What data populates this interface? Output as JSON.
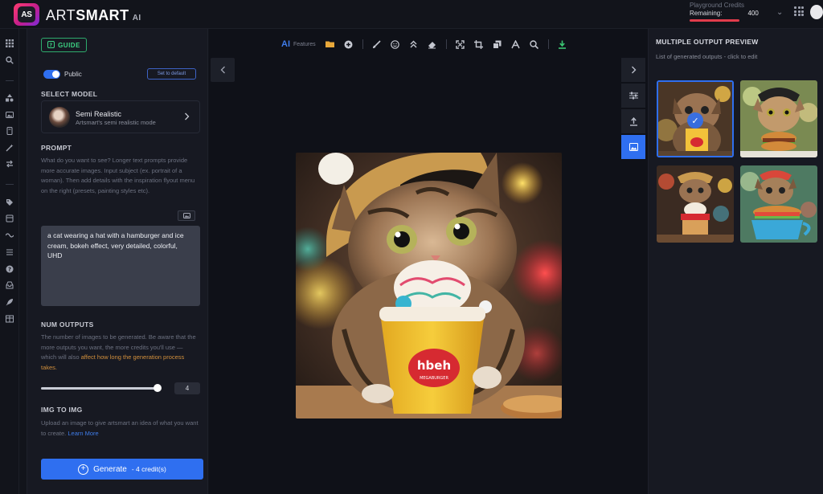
{
  "app": {
    "logo_badge": "AS",
    "logo_word1": "ART",
    "logo_word2": "SMART",
    "logo_suffix": "AI"
  },
  "credits": {
    "title": "Playground Credits",
    "remaining_label": "Remaining:",
    "remaining_value": "400",
    "bar_fraction": 1.0,
    "bar_color": "#e13c4b"
  },
  "rail_icons": [
    "grid-icon",
    "search-icon",
    "shapes-icon",
    "image-icon",
    "book-icon",
    "magic-wand-icon",
    "swap-icon",
    "tag-icon",
    "collection-icon",
    "wave-icon",
    "list-icon",
    "help-icon",
    "inbox-icon",
    "rocket-icon",
    "table-icon"
  ],
  "left": {
    "guide_label": "GUIDE",
    "public_label": "Public",
    "set_default_label": "Set to default",
    "select_model_label": "SELECT MODEL",
    "model_name": "Semi Realistic",
    "model_desc": "Artsmart's semi realistic mode",
    "prompt_label": "PROMPT",
    "prompt_help": "What do you want to see? Longer text prompts provide more accurate images. Input subject (ex. portrait of a woman). Then add details with the inspiration flyout menu on the right (presets, painting styles etc).",
    "prompt_value": "a cat wearing a hat with a hamburger and ice cream, bokeh effect, very detailed, colorful, UHD",
    "num_outputs_label": "NUM OUTPUTS",
    "num_outputs_help_1": "The number of images to be generated. Be aware that the more outputs you want, the more credits you'll use — which will also ",
    "num_outputs_help_hl": "affect how long the generation process takes.",
    "num_outputs_value": "4",
    "num_outputs_fraction": 1.0,
    "img2img_label": "IMG TO IMG",
    "img2img_help": "Upload an image to give artsmart an idea of what you want to create.",
    "learn_more": "Learn More",
    "generate_label": "Generate",
    "generate_credits": "- 4 credit(s)"
  },
  "toolbar": {
    "ai_label": "AI",
    "features_label": "Features",
    "icons": [
      "folder-icon",
      "plus-circle-icon",
      "brush-icon",
      "emoji-icon",
      "chevrons-up-icon",
      "eraser-icon",
      "expand-icon",
      "crop-icon",
      "layers-icon",
      "text-icon",
      "zoom-icon",
      "download-icon"
    ]
  },
  "right": {
    "title": "MULTIPLE OUTPUT PREVIEW",
    "subtitle": "List of generated outputs - click to edit"
  },
  "colors": {
    "accent": "#2f6ff0",
    "green": "#3dd384",
    "orange": "#d18f3c"
  }
}
